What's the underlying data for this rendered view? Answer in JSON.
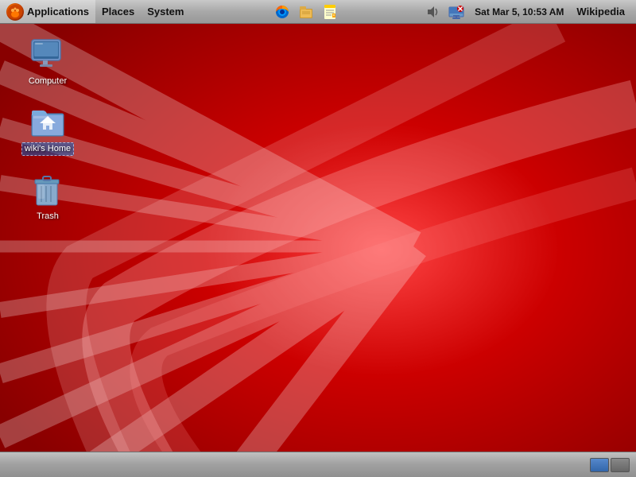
{
  "topbar": {
    "logo_alt": "GNOME foot logo",
    "applications_label": "Applications",
    "places_label": "Places",
    "system_label": "System",
    "datetime": "Sat Mar  5,  10:53 AM",
    "active_app": "Wikipedia",
    "icons": [
      {
        "name": "firefox-icon",
        "symbol": "🦊"
      },
      {
        "name": "files-icon",
        "symbol": "📁"
      },
      {
        "name": "notes-icon",
        "symbol": "📝"
      }
    ],
    "volume_icon": "🔈",
    "network_icon": "🖧"
  },
  "desktop": {
    "icons": [
      {
        "id": "computer",
        "label": "Computer",
        "selected": false
      },
      {
        "id": "wiki-home",
        "label": "wiki's Home",
        "selected": true
      },
      {
        "id": "trash",
        "label": "Trash",
        "selected": false
      }
    ]
  },
  "bottombar": {
    "workspaces": [
      {
        "id": 1,
        "active": true
      },
      {
        "id": 2,
        "active": false
      }
    ]
  }
}
